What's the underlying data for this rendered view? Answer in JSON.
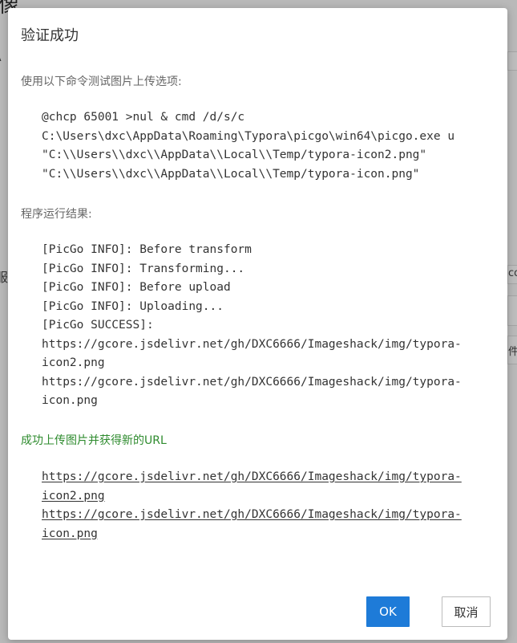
{
  "background": {
    "title_fragment": "像",
    "fragment_1": "A",
    "fragment_2": "服",
    "fragment_3": "co",
    "fragment_4": "件"
  },
  "dialog": {
    "title": "验证成功",
    "command_label": "使用以下命令测试图片上传选项:",
    "command_lines": [
      "@chcp 65001 >nul & cmd /d/s/c",
      "C:\\Users\\dxc\\AppData\\Roaming\\Typora\\picgo\\win64\\picgo.exe u",
      "\"C:\\\\Users\\\\dxc\\\\AppData\\\\Local\\\\Temp/typora-icon2.png\"",
      "\"C:\\\\Users\\\\dxc\\\\AppData\\\\Local\\\\Temp/typora-icon.png\""
    ],
    "result_label": "程序运行结果:",
    "result_lines": [
      "[PicGo INFO]: Before transform",
      "[PicGo INFO]: Transforming...",
      "[PicGo INFO]: Before upload",
      "[PicGo INFO]: Uploading...",
      "[PicGo SUCCESS]:",
      "https://gcore.jsdelivr.net/gh/DXC6666/Imageshack/img/typora-",
      "icon2.png",
      "https://gcore.jsdelivr.net/gh/DXC6666/Imageshack/img/typora-",
      "icon.png"
    ],
    "success_label": "成功上传图片并获得新的URL",
    "url_lines": [
      "https://gcore.jsdelivr.net/gh/DXC6666/Imageshack/img/typora-",
      "icon2.png",
      "https://gcore.jsdelivr.net/gh/DXC6666/Imageshack/img/typora-",
      "icon.png"
    ],
    "ok_label": "OK",
    "cancel_label": "取消"
  },
  "colors": {
    "primary": "#1e7bd8",
    "success": "#2e8b2e",
    "overlay": "#b9b9b9"
  }
}
